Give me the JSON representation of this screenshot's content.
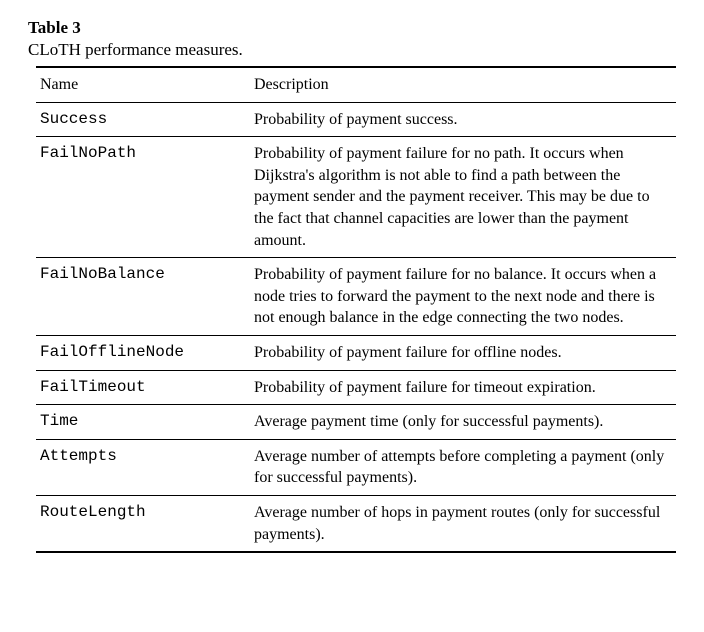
{
  "table": {
    "label": "Table 3",
    "caption": "CLoTH performance measures.",
    "headers": {
      "name": "Name",
      "description": "Description"
    },
    "rows": [
      {
        "name": "Success",
        "description": "Probability of payment success."
      },
      {
        "name": "FailNoPath",
        "description": "Probability of payment failure for no path. It occurs when Dijkstra's algorithm is not able to find a path between the payment sender and the payment receiver. This may be due to the fact that channel capacities are lower than the payment amount."
      },
      {
        "name": "FailNoBalance",
        "description": "Probability of payment failure for no balance. It occurs when a node tries to forward the payment to the next node and there is not enough balance in the edge connecting the two nodes."
      },
      {
        "name": "FailOfflineNode",
        "description": "Probability of payment failure for offline nodes."
      },
      {
        "name": "FailTimeout",
        "description": "Probability of payment failure for timeout expiration."
      },
      {
        "name": "Time",
        "description": "Average payment time (only for successful payments)."
      },
      {
        "name": "Attempts",
        "description": "Average number of attempts before completing a payment (only for successful payments)."
      },
      {
        "name": "RouteLength",
        "description": "Average number of hops in payment routes (only for successful payments)."
      }
    ]
  }
}
